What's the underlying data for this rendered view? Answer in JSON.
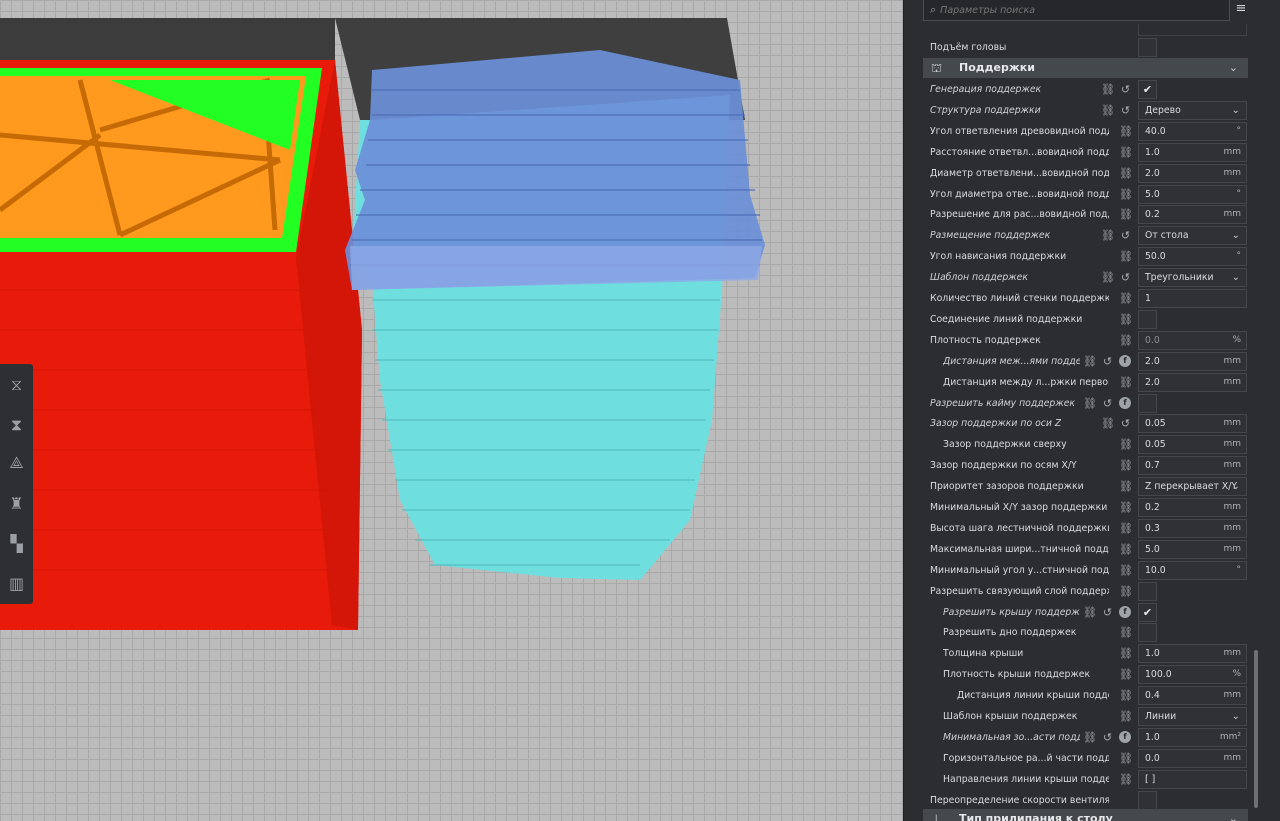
{
  "search": {
    "placeholder": "Параметры поиска"
  },
  "icons": {
    "search": "search-icon",
    "menu": "hamburger-menu-icon",
    "link": "link-icon",
    "reset": "reset-icon",
    "info": "function-icon",
    "chevron": "chevron-down-icon",
    "check": "checkmark-icon"
  },
  "colors": {
    "panel_bg": "#2b2d30",
    "section_bg": "#45484d",
    "model_red": "#ff1e00",
    "model_orange": "#ff9a1f",
    "model_green": "#1aff1a",
    "support_cyan": "#6fe0e0",
    "support_blue": "#6a8fd6"
  },
  "top_setting": {
    "label": "Подъём головы"
  },
  "section_supports": {
    "title": "Поддержки"
  },
  "section_adhesion": {
    "title": "Тип прилипания к столу"
  },
  "rows": [
    {
      "label": "Генерация поддержек",
      "value": "✔",
      "kind": "check"
    },
    {
      "label": "Структура поддержки",
      "value": "Дерево",
      "kind": "dd"
    },
    {
      "label": "Угол ответвления древовидной поддержки",
      "value": "40.0",
      "unit": "°"
    },
    {
      "label": "Расстояние ответвл...вовидной поддержки",
      "value": "1.0",
      "unit": "mm"
    },
    {
      "label": "Диаметр ответвлени...вовидной поддержки",
      "value": "2.0",
      "unit": "mm"
    },
    {
      "label": "Угол диаметра отве...вовидной поддержки",
      "value": "5.0",
      "unit": "°"
    },
    {
      "label": "Разрешение для рас...вовидной поддержки",
      "value": "0.2",
      "unit": "mm"
    },
    {
      "label": "Размещение поддержек",
      "value": "От стола",
      "kind": "dd"
    },
    {
      "label": "Угол нависания поддержки",
      "value": "50.0",
      "unit": "°"
    },
    {
      "label": "Шаблон поддержек",
      "value": "Треугольники",
      "kind": "dd"
    },
    {
      "label": "Количество линий стенки поддержки",
      "value": "1",
      "unit": ""
    },
    {
      "label": "Соединение линий поддержки",
      "value": "",
      "kind": "check"
    },
    {
      "label": "Плотность поддержек",
      "value": "0.0",
      "unit": "%"
    },
    {
      "label": "Дистанция меж...ями поддержки",
      "value": "2.0",
      "unit": "mm"
    },
    {
      "label": "Дистанция между л...ржки первого слоя",
      "value": "2.0",
      "unit": "mm"
    },
    {
      "label": "Разрешить кайму поддержек",
      "value": "",
      "kind": "check"
    },
    {
      "label": "Зазор поддержки по оси Z",
      "value": "0.05",
      "unit": "mm"
    },
    {
      "label": "Зазор поддержки сверху",
      "value": "0.05",
      "unit": "mm"
    },
    {
      "label": "Зазор поддержки по осям X/Y",
      "value": "0.7",
      "unit": "mm"
    },
    {
      "label": "Приоритет зазоров поддержки",
      "value": "Z перекрывает X/Y",
      "kind": "dd"
    },
    {
      "label": "Минимальный X/Y зазор поддержки",
      "value": "0.2",
      "unit": "mm"
    },
    {
      "label": "Высота шага лестничной поддержки",
      "value": "0.3",
      "unit": "mm"
    },
    {
      "label": "Максимальная шири...тничной поддержки",
      "value": "5.0",
      "unit": "mm"
    },
    {
      "label": "Минимальный угол у...стничной поддержки",
      "value": "10.0",
      "unit": "°"
    },
    {
      "label": "Разрешить связующий слой поддержки",
      "value": "",
      "kind": "check"
    },
    {
      "label": "Разрешить крышу поддержек",
      "value": "✔",
      "kind": "check"
    },
    {
      "label": "Разрешить дно поддержек",
      "value": "",
      "kind": "check"
    },
    {
      "label": "Толщина крыши",
      "value": "1.0",
      "unit": "mm"
    },
    {
      "label": "Плотность крыши поддержек",
      "value": "100.0",
      "unit": "%"
    },
    {
      "label": "Дистанция линии крыши поддержек",
      "value": "0.4",
      "unit": "mm"
    },
    {
      "label": "Шаблон крыши поддержек",
      "value": "Линии",
      "kind": "dd"
    },
    {
      "label": "Минимальная зо...асти поддержек",
      "value": "1.0",
      "unit": "mm²"
    },
    {
      "label": "Горизонтальное ра...й части поддержек",
      "value": "0.0",
      "unit": "mm"
    },
    {
      "label": "Направления линии крыши поддержек",
      "value": "[ ]",
      "unit": ""
    },
    {
      "label": "Переопределение скорости вентилятора",
      "value": "",
      "kind": "check"
    }
  ]
}
